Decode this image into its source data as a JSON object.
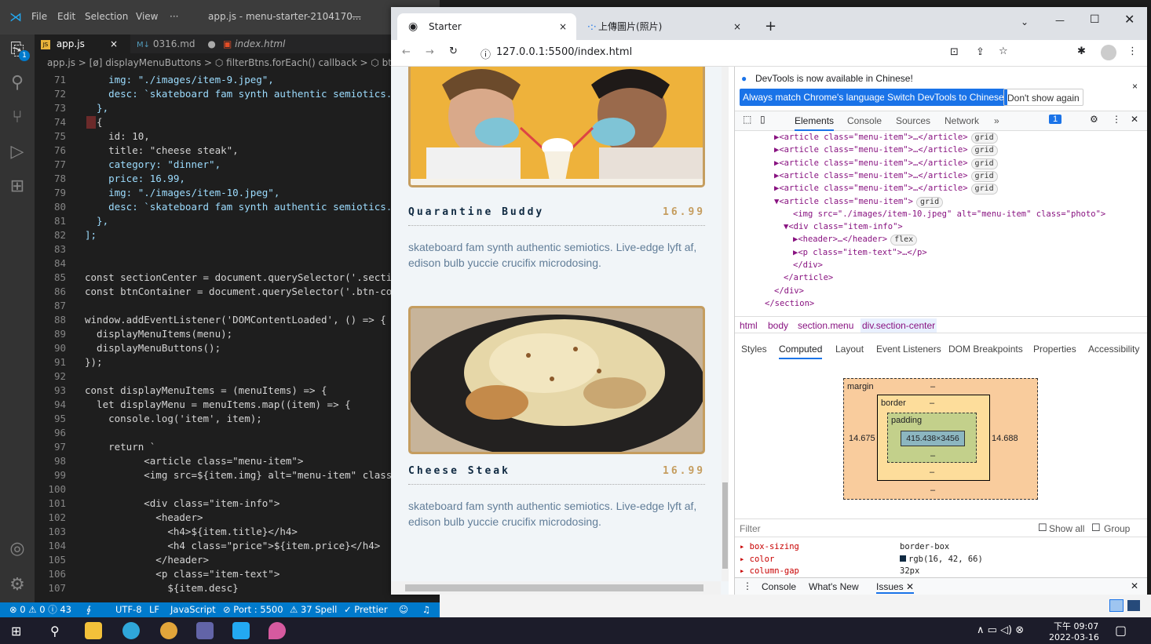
{
  "vscode": {
    "menu": [
      "File",
      "Edit",
      "Selection",
      "View",
      "···"
    ],
    "window_title": "app.js - menu-starter-2104170...",
    "tabs": [
      {
        "label": "app.js",
        "icon": "JS",
        "active": true,
        "close": "×"
      },
      {
        "label": "0316.md",
        "icon": "M↓",
        "modified_dot": "●"
      },
      {
        "label": "index.html",
        "icon": "html",
        "italic": true
      }
    ],
    "breadcrumb": "app.js > [ø] displayMenuButtons > ⬡ filterBtns.forEach() callback > ⬡ btn.ad",
    "activity_badge": "1",
    "lines": [
      {
        "n": "71",
        "t": "    img: \"./images/item-9.jpeg\","
      },
      {
        "n": "72",
        "t": "    desc: `skateboard fam synth authentic semiotics. L"
      },
      {
        "n": "73",
        "t": "  },"
      },
      {
        "n": "74",
        "t": "  {"
      },
      {
        "n": "75",
        "t": "    id: 10,"
      },
      {
        "n": "76",
        "t": "    title: \"cheese steak\","
      },
      {
        "n": "77",
        "t": "    category: \"dinner\","
      },
      {
        "n": "78",
        "t": "    price: 16.99,"
      },
      {
        "n": "79",
        "t": "    img: \"./images/item-10.jpeg\","
      },
      {
        "n": "80",
        "t": "    desc: `skateboard fam synth authentic semiotics. L"
      },
      {
        "n": "81",
        "t": "  },"
      },
      {
        "n": "82",
        "t": "];"
      },
      {
        "n": "83",
        "t": ""
      },
      {
        "n": "84",
        "t": ""
      },
      {
        "n": "85",
        "t": "const sectionCenter = document.querySelector('.sectio"
      },
      {
        "n": "86",
        "t": "const btnContainer = document.querySelector('.btn-con"
      },
      {
        "n": "87",
        "t": ""
      },
      {
        "n": "88",
        "t": "window.addEventListener('DOMContentLoaded', () => {"
      },
      {
        "n": "89",
        "t": "  displayMenuItems(menu);"
      },
      {
        "n": "90",
        "t": "  displayMenuButtons();"
      },
      {
        "n": "91",
        "t": "});"
      },
      {
        "n": "92",
        "t": ""
      },
      {
        "n": "93",
        "t": "const displayMenuItems = (menuItems) => {"
      },
      {
        "n": "94",
        "t": "  let displayMenu = menuItems.map((item) => {"
      },
      {
        "n": "95",
        "t": "    console.log('item', item);"
      },
      {
        "n": "96",
        "t": ""
      },
      {
        "n": "97",
        "t": "    return `"
      },
      {
        "n": "98",
        "t": "          <article class=\"menu-item\">"
      },
      {
        "n": "99",
        "t": "          <img src=${item.img} alt=\"menu-item\" class="
      },
      {
        "n": "100",
        "t": ""
      },
      {
        "n": "101",
        "t": "          <div class=\"item-info\">"
      },
      {
        "n": "102",
        "t": "            <header>"
      },
      {
        "n": "103",
        "t": "              <h4>${item.title}</h4>"
      },
      {
        "n": "104",
        "t": "              <h4 class=\"price\">${item.price}</h4>"
      },
      {
        "n": "105",
        "t": "            </header>"
      },
      {
        "n": "106",
        "t": "            <p class=\"item-text\">"
      },
      {
        "n": "107",
        "t": "              ${item.desc}"
      }
    ],
    "status": {
      "problems": "⊗ 0 ⚠ 0 ⓘ 43",
      "encoding": "UTF-8",
      "eol": "LF",
      "language": "JavaScript",
      "port": "⊘ Port : 5500",
      "spell": "⚠ 37 Spell",
      "prettier": "✓ Prettier"
    }
  },
  "chrome": {
    "tabs": [
      {
        "label": "Starter",
        "close": "×"
      },
      {
        "label": "上傳圖片(照片)",
        "close": "×"
      }
    ],
    "new_tab": "+",
    "url": "127.0.0.1:5500/index.html",
    "menu_items": [
      {
        "title": "Quarantine Buddy",
        "price": "16.99",
        "desc": "skateboard fam synth authentic semiotics. Live-edge lyft af, edison bulb yuccie crucifix microdosing."
      },
      {
        "title": "Cheese Steak",
        "price": "16.99",
        "desc": "skateboard fam synth authentic semiotics. Live-edge lyft af, edison bulb yuccie crucifix microdosing."
      }
    ]
  },
  "devtools": {
    "notice": "DevTools is now available in Chinese!",
    "btn_match": "Always match Chrome's language",
    "btn_switch": "Switch DevTools to Chinese",
    "btn_dont": "Don't show again",
    "tabs": [
      "Elements",
      "Console",
      "Sources",
      "Network",
      "»"
    ],
    "issues_badge": "1",
    "dom_lines": [
      {
        "indent": 0,
        "text": "▶<article class=\"menu-item\">…</article>",
        "badge": "grid"
      },
      {
        "indent": 0,
        "text": "▶<article class=\"menu-item\">…</article>",
        "badge": "grid"
      },
      {
        "indent": 0,
        "text": "▶<article class=\"menu-item\">…</article>",
        "badge": "grid"
      },
      {
        "indent": 0,
        "text": "▶<article class=\"menu-item\">…</article>",
        "badge": "grid"
      },
      {
        "indent": 0,
        "text": "▶<article class=\"menu-item\">…</article>",
        "badge": "grid"
      },
      {
        "indent": 0,
        "text": "▼<article class=\"menu-item\">",
        "badge": "grid"
      },
      {
        "indent": 2,
        "text": "<img src=\"./images/item-10.jpeg\" alt=\"menu-item\" class=\"photo\">",
        "badge": ""
      },
      {
        "indent": 1,
        "text": "▼<div class=\"item-info\">",
        "badge": ""
      },
      {
        "indent": 2,
        "text": "▶<header>…</header>",
        "badge": "flex"
      },
      {
        "indent": 2,
        "text": "▶<p class=\"item-text\">…</p>",
        "badge": ""
      },
      {
        "indent": 2,
        "text": "</div>",
        "badge": ""
      },
      {
        "indent": 1,
        "text": "</article>",
        "badge": ""
      },
      {
        "indent": 0,
        "text": "</div>",
        "badge": ""
      },
      {
        "indent": -1,
        "text": "</section>",
        "badge": ""
      }
    ],
    "crumbs": [
      "html",
      "body",
      "section.menu",
      "div.section-center"
    ],
    "subtabs": [
      "Styles",
      "Computed",
      "Layout",
      "Event Listeners",
      "DOM Breakpoints",
      "Properties",
      "Accessibility"
    ],
    "box": {
      "margin_label": "margin",
      "border_label": "border",
      "padding_label": "padding",
      "dash": "–",
      "left": "14.675",
      "right": "14.688",
      "content": "415.438×3456"
    },
    "filter_placeholder": "Filter",
    "show_all": "Show all",
    "group": "Group",
    "props": [
      {
        "name": "box-sizing",
        "value": "border-box"
      },
      {
        "name": "color",
        "value": "rgb(16, 42, 66)"
      },
      {
        "name": "column-gap",
        "value": "32px"
      }
    ],
    "drawer_tabs": [
      "Console",
      "What's New",
      "Issues"
    ]
  },
  "taskbar": {
    "time": "下午 09:07",
    "date": "2022-03-16"
  },
  "colors": {
    "accent": "#c59d5f",
    "vscode_status": "#007acc",
    "devtools_blue": "#1a73e8"
  }
}
